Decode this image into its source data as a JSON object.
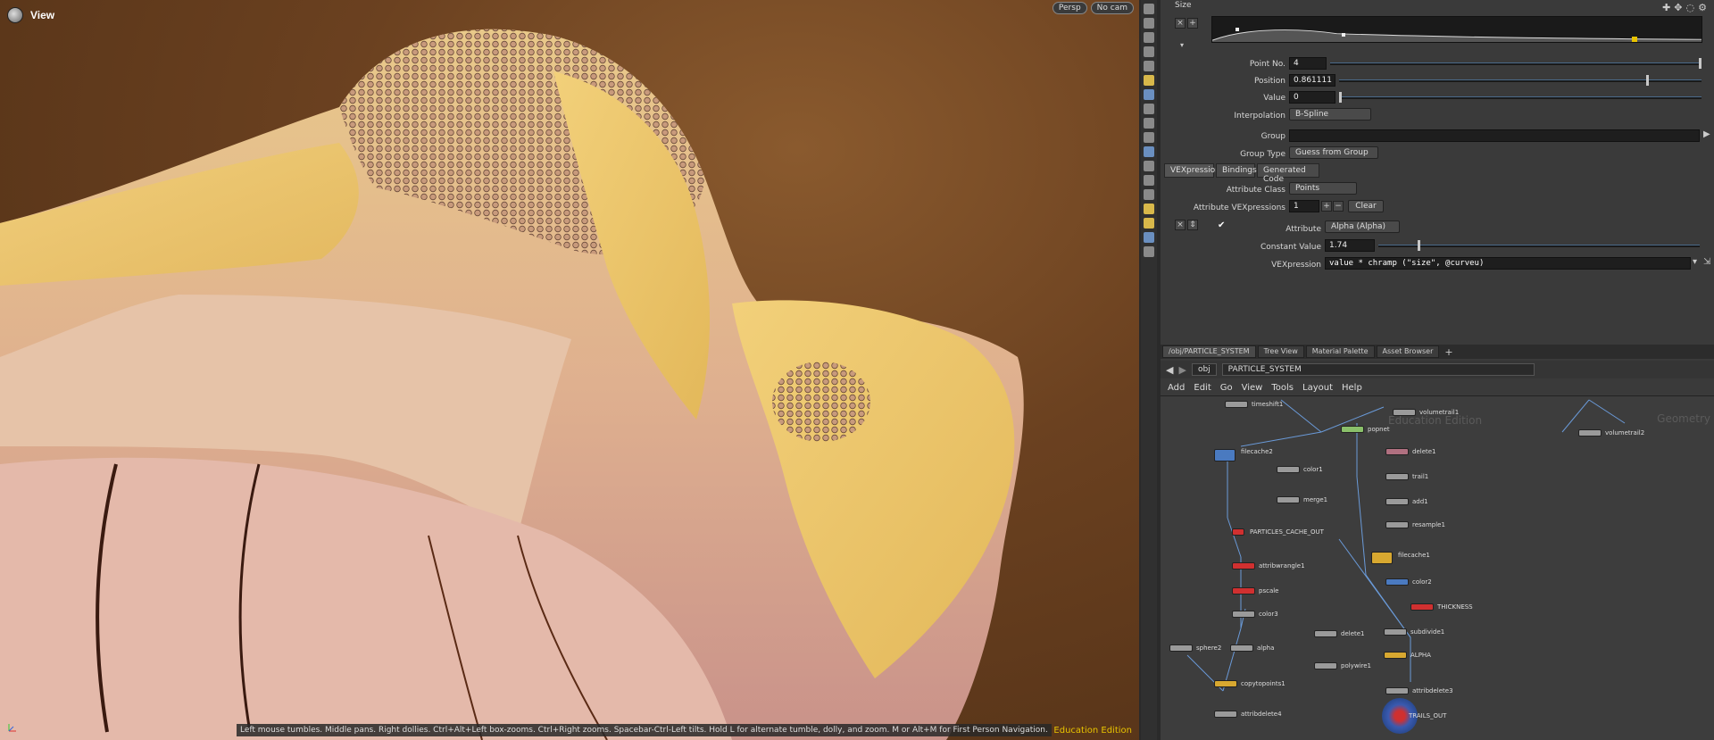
{
  "viewport": {
    "title": "View",
    "persp_label": "Persp",
    "cam_label": "No cam",
    "hint": "Left mouse tumbles. Middle pans. Right dollies. Ctrl+Alt+Left box-zooms. Ctrl+Right zooms. Spacebar-Ctrl-Left tilts. Hold L for alternate tumble, dolly, and zoom. M or Alt+M for First Person Navigation.",
    "edition": "Education Edition"
  },
  "params": {
    "ramp_label": "Size",
    "point_no_label": "Point No.",
    "point_no": "4",
    "position_label": "Position",
    "position": "0.861111",
    "position_value": 0.861111,
    "value_label": "Value",
    "value": "0",
    "interpolation_label": "Interpolation",
    "interpolation": "B-Spline",
    "group_label": "Group",
    "group_type_label": "Group Type",
    "group_type": "Guess from Group",
    "tabs": [
      "VEXpressions",
      "Bindings",
      "Generated Code"
    ],
    "attribute_class_label": "Attribute Class",
    "attribute_class": "Points",
    "attr_vex_label": "Attribute VEXpressions",
    "attr_vex_count": "1",
    "clear_label": "Clear",
    "attribute_label": "Attribute",
    "attribute": "Alpha (Alpha)",
    "constant_label": "Constant Value",
    "constant": "1.74",
    "vexpression_label": "VEXpression",
    "vexpression": "value * chramp (\"size\", @curveu)"
  },
  "network": {
    "tabs": [
      "/obj/PARTICLE_SYSTEM",
      "Tree View",
      "Material Palette",
      "Asset Browser"
    ],
    "path_obj": "obj",
    "path_node": "PARTICLE_SYSTEM",
    "menu": [
      "Add",
      "Edit",
      "Go",
      "View",
      "Tools",
      "Layout",
      "Help"
    ],
    "watermark_edu": "Education Edition",
    "watermark_geo": "Geometry",
    "nodes": {
      "timeshift1": "timeshift1",
      "volumetrail1": "volumetrail1",
      "volumetrail2": "volumetrail2",
      "popnet": "popnet",
      "filecache2": "filecache2",
      "color1": "color1",
      "merge1": "merge1",
      "delete1": "delete1",
      "trail1": "trail1",
      "add1": "add1",
      "resample1": "resample1",
      "particles_cache_out": "PARTICLES_CACHE_OUT",
      "attribwrangle1": "attribwrangle1",
      "pscale": "pscale",
      "color3": "color3",
      "filecache1": "filecache1",
      "color2": "color2",
      "thickness": "THICKNESS",
      "sphere2": "sphere2",
      "alpha": "alpha",
      "delete1b": "delete1",
      "polywire1": "polywire1",
      "subdivide1": "subdivide1",
      "alpha2": "ALPHA",
      "copytopoints1": "copytopoints1",
      "attribdelete3": "attribdelete3",
      "attribdelete4": "attribdelete4",
      "trails_out": "TRAILS_OUT"
    }
  }
}
